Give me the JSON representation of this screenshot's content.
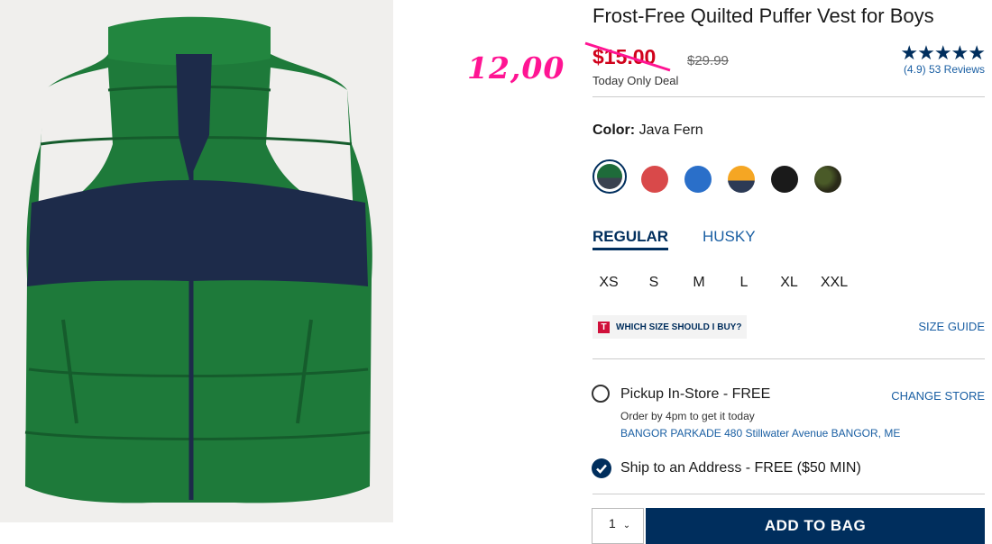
{
  "annotation": {
    "handwritten_price": "12,00",
    "color": "#ff1493"
  },
  "product": {
    "title": "Frost-Free Quilted Puffer Vest for Boys",
    "sale_price": "$15.00",
    "original_price": "$29.99",
    "deal_label": "Today Only Deal",
    "rating": {
      "stars": "★★★★★",
      "score": "(4.9)",
      "reviews": "53 Reviews"
    }
  },
  "color": {
    "label": "Color:",
    "selected_name": "Java Fern",
    "swatches": [
      {
        "name": "green-navy",
        "colors": [
          "#1e6b3a",
          "#3a4250"
        ],
        "selected": true
      },
      {
        "name": "red",
        "colors": [
          "#d9494a",
          "#d9494a"
        ]
      },
      {
        "name": "blue",
        "colors": [
          "#2a6fc9",
          "#2a6fc9"
        ]
      },
      {
        "name": "yellow-navy",
        "colors": [
          "#f5a623",
          "#2c3a55"
        ]
      },
      {
        "name": "black",
        "colors": [
          "#1a1a1a",
          "#1a1a1a"
        ]
      },
      {
        "name": "camo",
        "colors": [
          "#3b3b22",
          "#2e3420"
        ]
      }
    ]
  },
  "fit": {
    "tabs": [
      "REGULAR",
      "HUSKY"
    ],
    "active": "REGULAR"
  },
  "sizes": [
    "XS",
    "S",
    "M",
    "L",
    "XL",
    "XXL"
  ],
  "size_help": {
    "badge": "T",
    "label": "WHICH SIZE SHOULD I BUY?",
    "guide_link": "SIZE GUIDE"
  },
  "fulfillment": {
    "pickup_label": "Pickup In-Store - FREE",
    "change_store": "CHANGE STORE",
    "pickup_note": "Order by 4pm to get it today",
    "store_address": "BANGOR PARKADE 480 Stillwater Avenue  BANGOR, ME",
    "ship_label": "Ship to an Address - FREE ($50 MIN)"
  },
  "cart": {
    "quantity": "1",
    "add_to_bag": "ADD TO BAG"
  },
  "colors": {
    "navy": "#002e5d",
    "sale_red": "#d0021b",
    "link_blue": "#1a5fa3"
  }
}
